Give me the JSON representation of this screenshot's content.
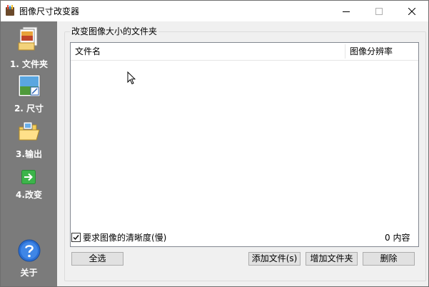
{
  "window": {
    "title": "图像尺寸改变器"
  },
  "sidebar": {
    "items": [
      {
        "label": "1. 文件夹",
        "icon": "folder-images-icon"
      },
      {
        "label": "2. 尺寸",
        "icon": "picture-resize-icon"
      },
      {
        "label": "3.输出",
        "icon": "output-folder-icon"
      },
      {
        "label": "4.改变",
        "icon": "green-arrow-icon"
      }
    ],
    "about": {
      "label": "关于",
      "icon": "help-question-icon"
    }
  },
  "main": {
    "group_title": "改变图像大小的文件夹",
    "list": {
      "columns": [
        "文件名",
        "图像分辨率"
      ],
      "rows": []
    },
    "checkbox": {
      "label": "要求图像的清晰度(慢)",
      "checked": true
    },
    "count": "0 内容",
    "buttons": {
      "select_all": "全选",
      "add_files": "添加文件(s)",
      "add_folder": "增加文件夹",
      "delete": "删除"
    }
  },
  "colors": {
    "sidebar_bg": "#7b7b7b",
    "window_bg": "#f0f0f0",
    "title_bg": "#ffffff"
  }
}
